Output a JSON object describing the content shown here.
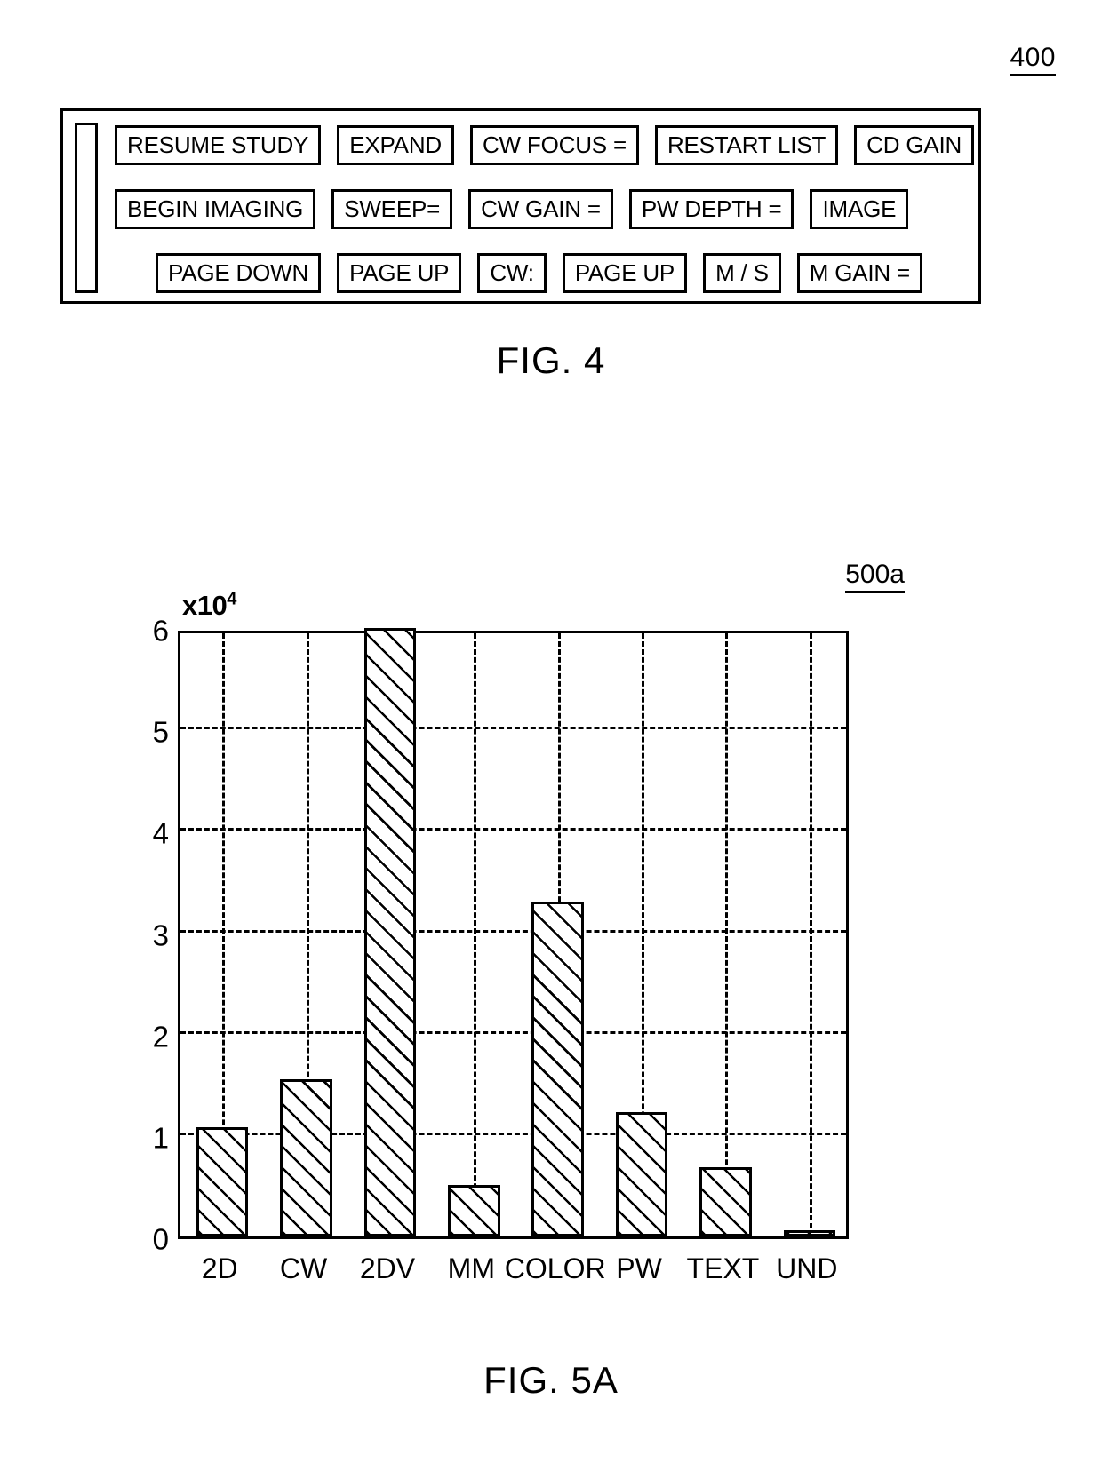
{
  "figure4": {
    "reference_numeral": "400",
    "caption": "FIG. 4",
    "panel_rows": [
      [
        {
          "label": "RESUME STUDY"
        },
        {
          "label": "EXPAND"
        },
        {
          "label": "CW FOCUS ="
        },
        {
          "label": "RESTART LIST"
        },
        {
          "label": "CD GAIN"
        }
      ],
      [
        {
          "label": "BEGIN IMAGING"
        },
        {
          "label": "SWEEP="
        },
        {
          "label": "CW GAIN ="
        },
        {
          "label": "PW DEPTH ="
        },
        {
          "label": "IMAGE"
        }
      ],
      [
        {
          "label": "PAGE DOWN"
        },
        {
          "label": "PAGE UP"
        },
        {
          "label": "CW:"
        },
        {
          "label": "PAGE UP"
        },
        {
          "label": "M / S"
        },
        {
          "label": "M GAIN ="
        }
      ]
    ]
  },
  "figure5a": {
    "reference_numeral": "500a",
    "caption": "FIG. 5A"
  },
  "chart_data": {
    "type": "bar",
    "title": "",
    "xlabel": "",
    "ylabel": "",
    "y_axis_multiplier": "x10",
    "y_axis_exponent": "4",
    "categories": [
      "2D",
      "CW",
      "2DV",
      "MM",
      "COLOR",
      "PW",
      "TEXT",
      "UND"
    ],
    "values": [
      1.08,
      1.55,
      6.0,
      0.51,
      3.3,
      1.23,
      0.68,
      0.05
    ],
    "value_note_2dv": "clipped at axis maximum",
    "ylim": [
      0,
      6
    ],
    "yticks": [
      0,
      1,
      2,
      3,
      4,
      5,
      6
    ],
    "ytick_labels": [
      "0",
      "1",
      "2",
      "3",
      "4",
      "5",
      "6"
    ],
    "grid": "dashed horizontal and vertical",
    "legend": "none",
    "bar_fill": "diagonal hatch",
    "colors": {
      "line": "#000000",
      "background": "#ffffff"
    }
  }
}
